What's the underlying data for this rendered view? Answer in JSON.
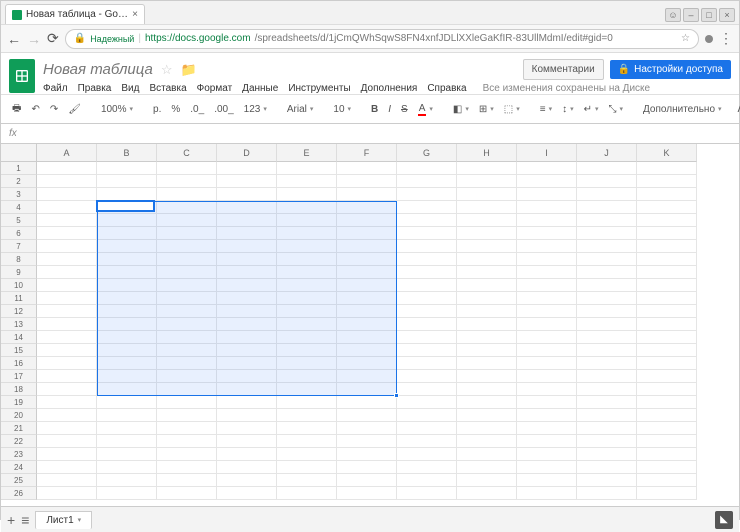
{
  "browser": {
    "tab_title": "Новая таблица - Google",
    "secure_label": "Надежный",
    "url_host": "https://docs.google.com",
    "url_path": "/spreadsheets/d/1jCmQWhSqwS8FN4xnfJDLlXXleGaKfIR-83UllMdmI/edit#gid=0"
  },
  "doc": {
    "title": "Новая таблица",
    "comments_btn": "Комментарии",
    "share_btn": "Настройки доступа",
    "save_status": "Все изменения сохранены на Диске"
  },
  "menus": [
    "Файл",
    "Правка",
    "Вид",
    "Вставка",
    "Формат",
    "Данные",
    "Инструменты",
    "Дополнения",
    "Справка"
  ],
  "toolbar": {
    "zoom": "100%",
    "currency": "р.",
    "percent": "%",
    "dec_dec": ".0_",
    "dec_inc": ".00_",
    "more_fmt": "123",
    "font": "Arial",
    "size": "10",
    "more": "Дополнительно"
  },
  "fx": "fx",
  "columns": [
    "A",
    "B",
    "C",
    "D",
    "E",
    "F",
    "G",
    "H",
    "I",
    "J",
    "K"
  ],
  "rows": 26,
  "selection": {
    "startCol": 1,
    "endCol": 5,
    "startRow": 3,
    "endRow": 17,
    "activeCol": 1,
    "activeRow": 3
  },
  "sheet_tab": "Лист1"
}
